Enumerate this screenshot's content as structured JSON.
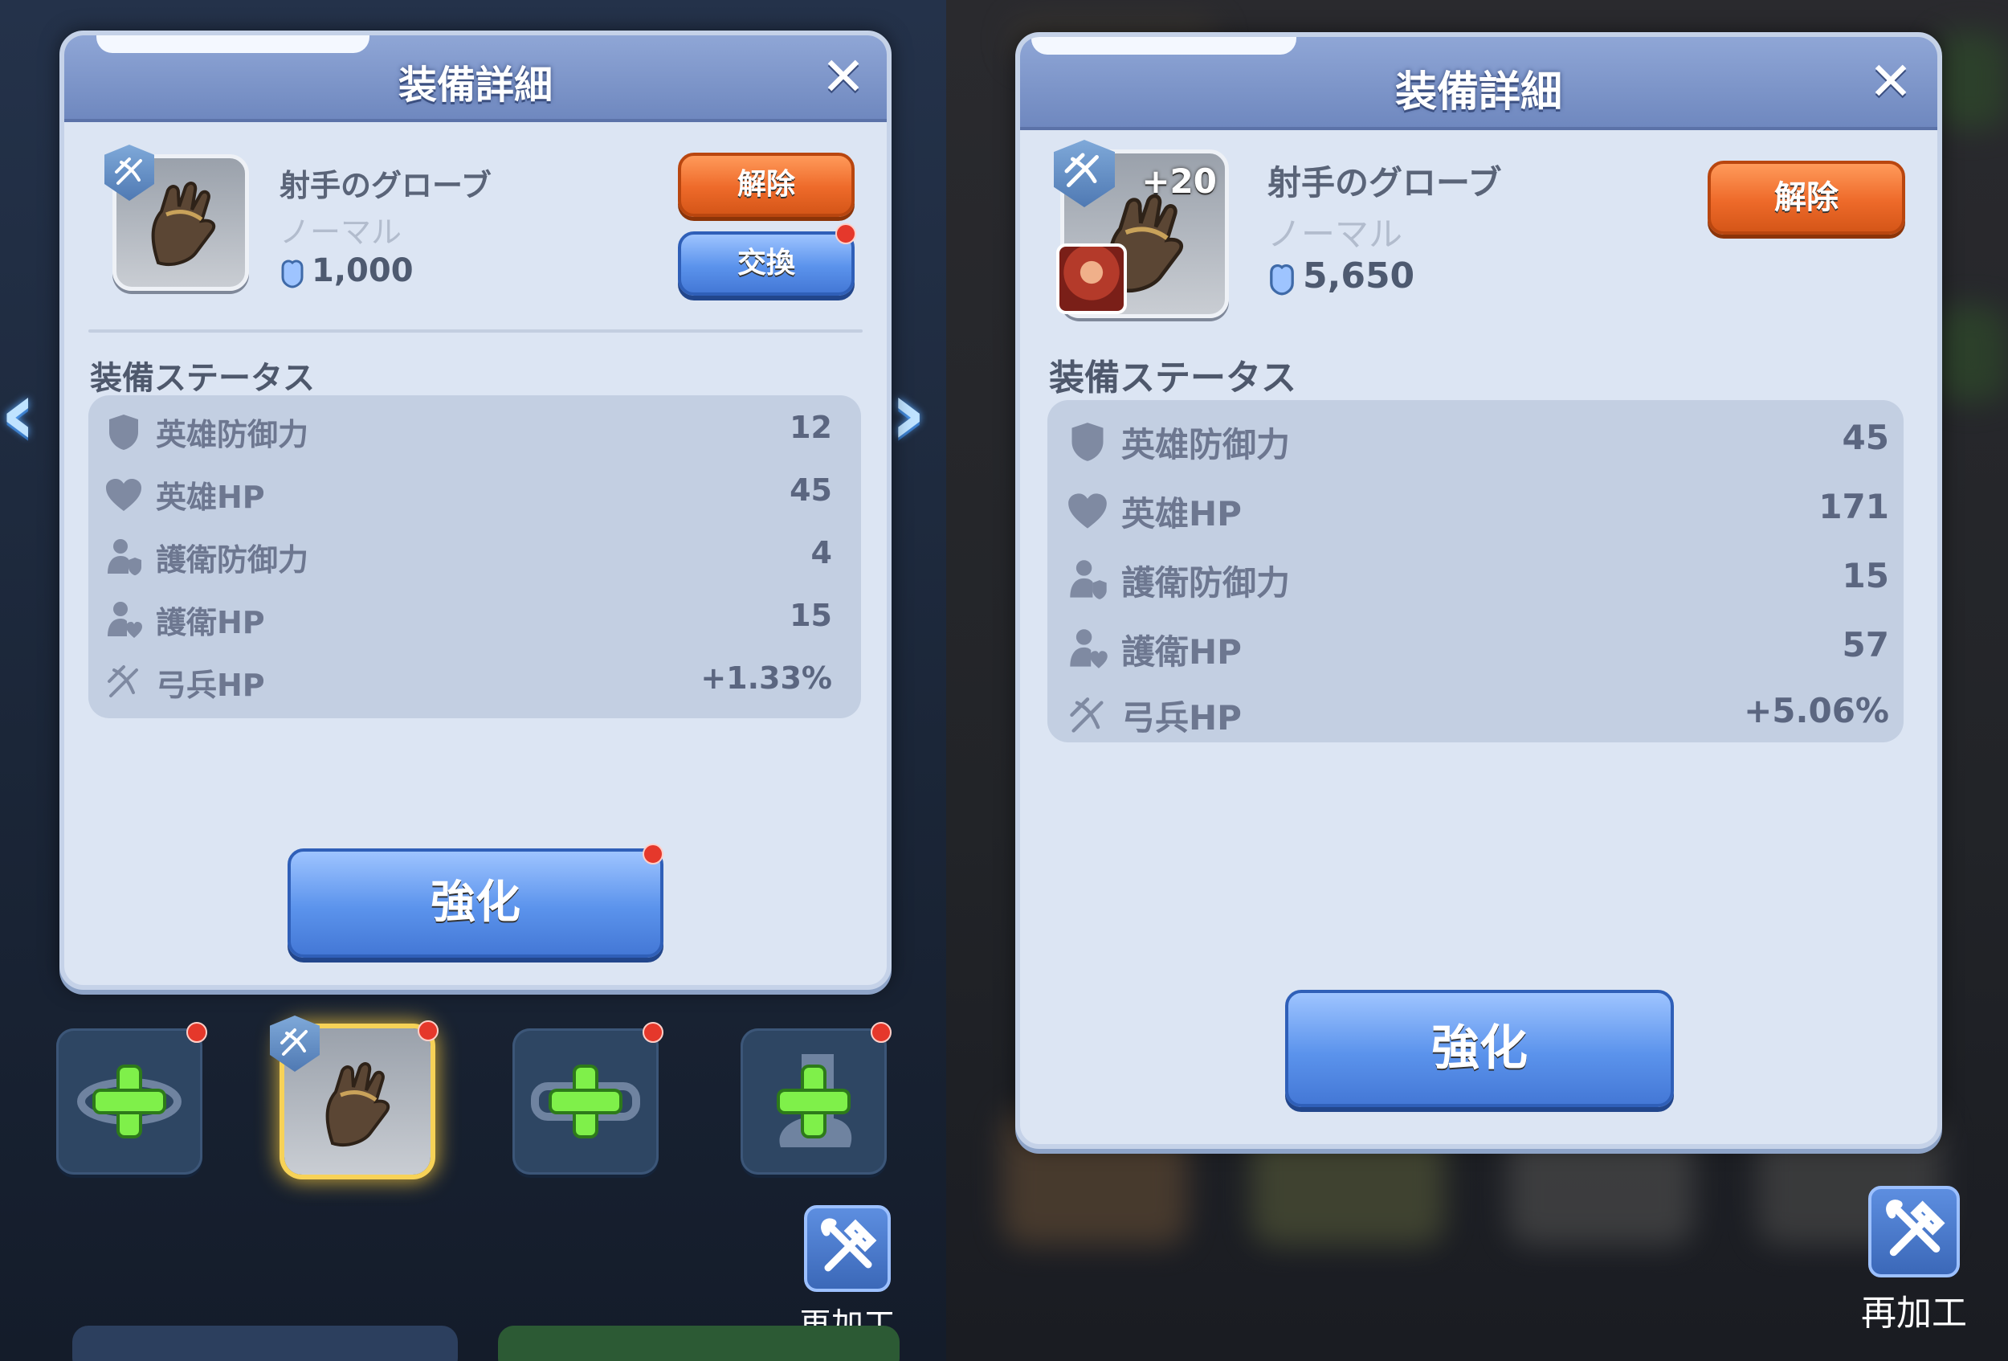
{
  "left": {
    "panel": {
      "title": "装備詳細",
      "close_icon": "close-icon",
      "item": {
        "name": "射手のグローブ",
        "rarity": "ノーマル",
        "power": "1,000",
        "class_badge": "crossbow-icon",
        "image": "glove-icon"
      },
      "buttons": {
        "unequip": "解除",
        "swap": "交換",
        "enhance": "強化"
      },
      "status_title": "装備ステータス",
      "stats": [
        {
          "icon": "shield-icon",
          "label": "英雄防御力",
          "value": "12"
        },
        {
          "icon": "heart-icon",
          "label": "英雄HP",
          "value": "45"
        },
        {
          "icon": "guard-defense-icon",
          "label": "護衛防御力",
          "value": "4"
        },
        {
          "icon": "guard-hp-icon",
          "label": "護衛HP",
          "value": "15"
        },
        {
          "icon": "archer-icon",
          "label": "弓兵HP",
          "value": "+1.33%"
        }
      ]
    },
    "slots": [
      {
        "name": "empty-slot-ring",
        "icon": "add-icon"
      },
      {
        "name": "glove-slot",
        "icon": "glove-icon"
      },
      {
        "name": "empty-slot-belt",
        "icon": "add-icon"
      },
      {
        "name": "empty-slot-boots",
        "icon": "add-icon"
      }
    ],
    "rework_label": "再加工"
  },
  "right": {
    "panel": {
      "title": "装備詳細",
      "close_icon": "close-icon",
      "item": {
        "name": "射手のグローブ",
        "rarity": "ノーマル",
        "power": "5,650",
        "level": "+20",
        "class_badge": "crossbow-icon",
        "image": "glove-icon"
      },
      "buttons": {
        "unequip": "解除",
        "enhance": "強化"
      },
      "status_title": "装備ステータス",
      "stats": [
        {
          "icon": "shield-icon",
          "label": "英雄防御力",
          "value": "45"
        },
        {
          "icon": "heart-icon",
          "label": "英雄HP",
          "value": "171"
        },
        {
          "icon": "guard-defense-icon",
          "label": "護衛防御力",
          "value": "15"
        },
        {
          "icon": "guard-hp-icon",
          "label": "護衛HP",
          "value": "57"
        },
        {
          "icon": "archer-icon",
          "label": "弓兵HP",
          "value": "+5.06%"
        }
      ]
    },
    "rework_label": "再加工"
  },
  "colors": {
    "panel_bg": "#dce5f3",
    "header_bg": "#7a93c9",
    "orange_button": "#ee6a2a",
    "blue_button": "#5b93ec",
    "notification_dot": "#e5382b"
  }
}
